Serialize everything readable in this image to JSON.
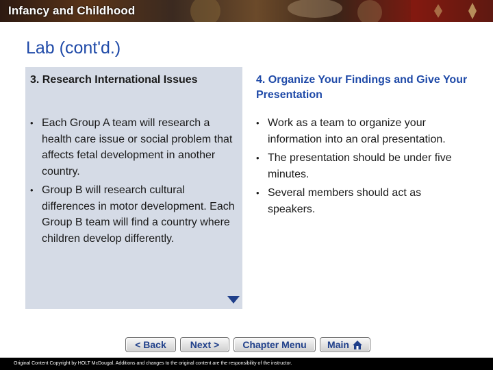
{
  "header": {
    "title": "Infancy and Childhood"
  },
  "page": {
    "title": "Lab (cont'd.)"
  },
  "left_column": {
    "heading": "3. Research International Issues",
    "bullets": [
      "Each Group A team will research a health care issue or social problem that affects fetal development in another country.",
      "Group B will research cultural differences in motor development. Each Group B team will find a country where children develop differently."
    ]
  },
  "right_column": {
    "heading": "4. Organize Your Findings and Give Your Presentation",
    "bullets": [
      "Work as a team to organize your information into an oral presentation.",
      "The presentation should be under five minutes.",
      "Several members should act as speakers."
    ]
  },
  "bullet_glyph": "•",
  "nav": {
    "back_label": "< Back",
    "next_label": "Next >",
    "chapter_menu_label": "Chapter Menu",
    "main_label": "Main"
  },
  "footer": {
    "text": "Original Content Copyright by HOLT McDougal. Additions and changes to the original content are the responsibility of the instructor."
  },
  "colors": {
    "title_blue": "#1f4aa8",
    "panel_bg": "#d5dbe6",
    "footer_bg": "#000000"
  }
}
